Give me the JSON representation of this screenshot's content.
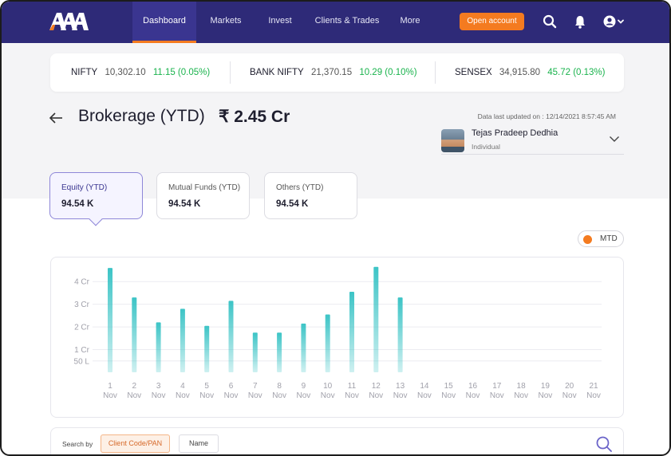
{
  "app": {
    "logo_text": "AAA"
  },
  "nav": {
    "items": [
      {
        "label": "Dashboard",
        "active": true
      },
      {
        "label": "Markets",
        "active": false
      },
      {
        "label": "Invest",
        "active": false
      },
      {
        "label": "Clients & Trades",
        "active": false
      },
      {
        "label": "More",
        "active": false
      }
    ],
    "open_account_label": "Open account",
    "icons": [
      "search-icon",
      "bell-icon",
      "user-circle-icon",
      "chevron-down-icon"
    ]
  },
  "ticker": [
    {
      "name": "NIFTY",
      "value": "10,302.10",
      "change": "11.15 (0.05%)"
    },
    {
      "name": "BANK NIFTY",
      "value": "21,370.15",
      "change": "10.29 (0.10%)"
    },
    {
      "name": "SENSEX",
      "value": "34,915.80",
      "change": "45.72 (0.13%)"
    }
  ],
  "header": {
    "title": "Brokerage (YTD)",
    "amount": "₹ 2.45 Cr",
    "last_updated": "Data last updated on : 12/14/2021 8:57:45 AM"
  },
  "user": {
    "name": "Tejas Pradeep Dedhia",
    "type": "Individual"
  },
  "cards": [
    {
      "label": "Equity (YTD)",
      "amount": "94.54 K",
      "active": true
    },
    {
      "label": "Mutual Funds (YTD)",
      "amount": "94.54 K",
      "active": false
    },
    {
      "label": "Others (YTD)",
      "amount": "94.54 K",
      "active": false
    }
  ],
  "toggle": {
    "label": "MTD"
  },
  "search": {
    "label": "Search by",
    "options": [
      "Client Code/PAN",
      "Name"
    ],
    "active_option": "Client Code/PAN"
  },
  "colors": {
    "nav_bg": "#2e2a78",
    "accent": "#f47b20",
    "positive": "#1ab34d",
    "bar": "#3cc4c6",
    "card_active_border": "#8e87d8"
  },
  "chart_data": {
    "type": "bar",
    "categories": [
      "1",
      "2",
      "3",
      "4",
      "5",
      "6",
      "7",
      "8",
      "9",
      "10",
      "11",
      "12",
      "13",
      "14",
      "15",
      "16",
      "17",
      "18",
      "19",
      "20",
      "21"
    ],
    "category_sublabel": "Nov",
    "y_ticks": [
      "50 L",
      "1 Cr",
      "2 Cr",
      "3 Cr",
      "4 Cr"
    ],
    "ylim": [
      0,
      4.5
    ],
    "values": [
      4.6,
      3.3,
      2.2,
      2.8,
      2.05,
      3.15,
      1.75,
      1.75,
      2.15,
      2.55,
      3.55,
      4.65,
      3.3,
      null,
      null,
      null,
      null,
      null,
      null,
      null,
      null
    ],
    "unit": "Cr",
    "grid": true,
    "xlabel": "",
    "ylabel": ""
  }
}
